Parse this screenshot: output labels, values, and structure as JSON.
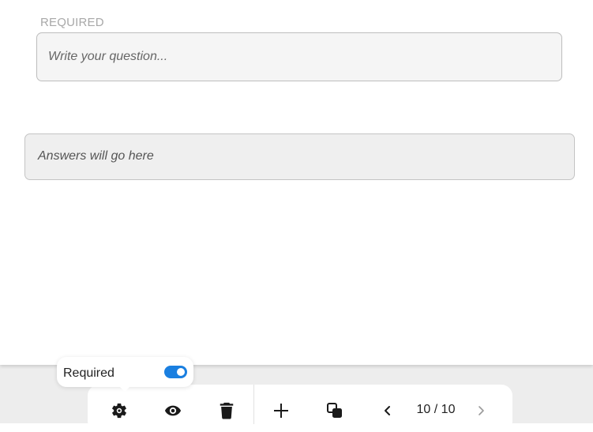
{
  "question": {
    "required_label": "REQUIRED",
    "placeholder": "Write your question..."
  },
  "answers": {
    "placeholder_text": "Answers will go here"
  },
  "popover": {
    "label": "Required",
    "toggle_on": true,
    "toggle_color": "#1a7fe0"
  },
  "toolbar": {
    "icons": [
      "gear-icon",
      "eye-icon",
      "trash-icon",
      "plus-icon",
      "duplicate-icon",
      "chevron-left-icon",
      "chevron-right-icon"
    ],
    "page_counter": "10 / 10"
  }
}
